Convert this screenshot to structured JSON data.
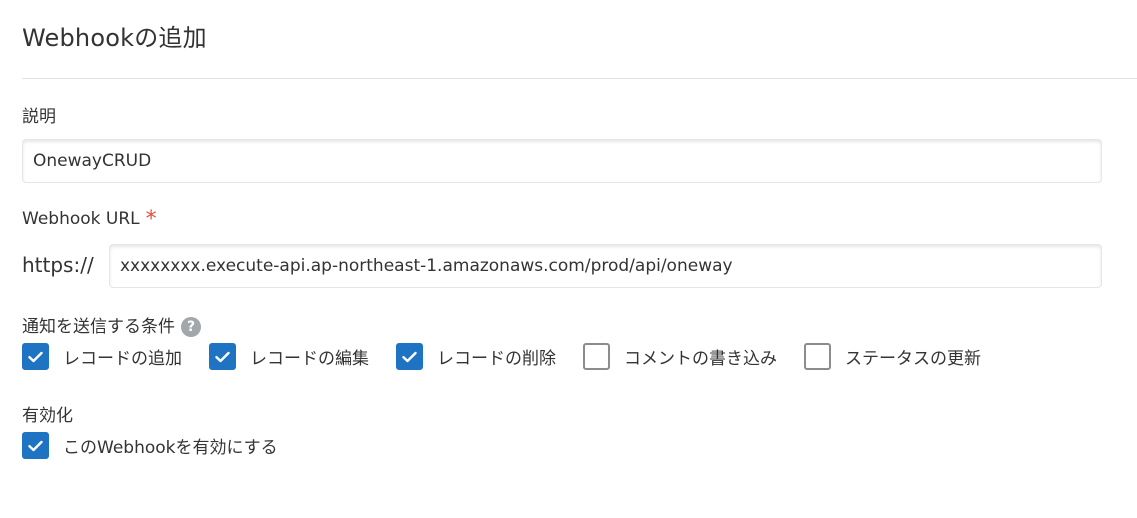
{
  "page": {
    "title": "Webhookの追加"
  },
  "description": {
    "label": "説明",
    "value": "OnewayCRUD"
  },
  "webhook_url": {
    "label": "Webhook URL",
    "required_mark": "*",
    "prefix": "https://",
    "value": "xxxxxxxx.execute-api.ap-northeast-1.amazonaws.com/prod/api/oneway"
  },
  "conditions": {
    "label": "通知を送信する条件",
    "help_icon": "question-circle-icon",
    "items": [
      {
        "label": "レコードの追加",
        "checked": true
      },
      {
        "label": "レコードの編集",
        "checked": true
      },
      {
        "label": "レコードの削除",
        "checked": true
      },
      {
        "label": "コメントの書き込み",
        "checked": false
      },
      {
        "label": "ステータスの更新",
        "checked": false
      }
    ]
  },
  "enable": {
    "label": "有効化",
    "checkbox_label": "このWebhookを有効にする",
    "checked": true
  },
  "colors": {
    "checkbox_checked": "#1e74c2",
    "required": "#e74c3c",
    "help_icon": "#a2a7ab"
  }
}
